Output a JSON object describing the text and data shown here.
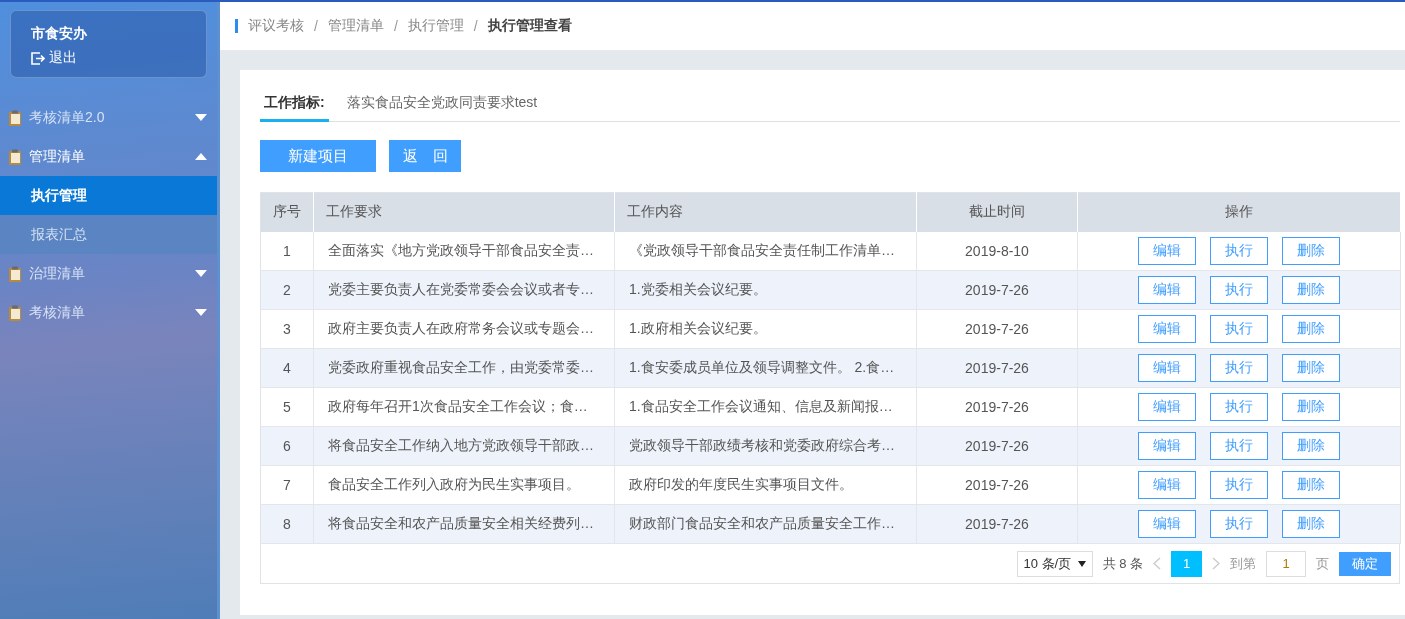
{
  "user": {
    "name": "市食安办",
    "logout": "退出"
  },
  "sidebar": {
    "items": [
      {
        "label": "考核清单2.0",
        "expanded": false
      },
      {
        "label": "管理清单",
        "expanded": true,
        "children": [
          {
            "label": "执行管理",
            "selected": true
          },
          {
            "label": "报表汇总",
            "selected": false
          }
        ]
      },
      {
        "label": "治理清单",
        "expanded": false
      },
      {
        "label": "考核清单",
        "expanded": false
      }
    ]
  },
  "breadcrumb_separator": "/",
  "breadcrumb": [
    {
      "label": "评议考核",
      "current": false
    },
    {
      "label": "管理清单",
      "current": false
    },
    {
      "label": "执行管理",
      "current": false
    },
    {
      "label": "执行管理查看",
      "current": true
    }
  ],
  "tabs": [
    {
      "label": "工作指标:",
      "selected": true
    }
  ],
  "indicator": "落实食品安全党政同责要求test",
  "buttons": [
    "新建项目",
    "返　回"
  ],
  "table": {
    "columns": [
      "序号",
      "工作要求",
      "工作内容",
      "截止时间",
      "操作"
    ],
    "rows": [
      {
        "no": "1",
        "requirement": "全面落实《地方党政领导干部食品安全责…",
        "content": "《党政领导干部食品安全责任制工作清单…",
        "deadline": "2019-8-10",
        "actions": [
          "编辑",
          "执行",
          "删除"
        ]
      },
      {
        "no": "2",
        "requirement": "党委主要负责人在党委常委会会议或者专…",
        "content": "1.党委相关会议纪要。",
        "deadline": "2019-7-26",
        "actions": [
          "编辑",
          "执行",
          "删除"
        ]
      },
      {
        "no": "3",
        "requirement": "政府主要负责人在政府常务会议或专题会…",
        "content": "1.政府相关会议纪要。",
        "deadline": "2019-7-26",
        "actions": [
          "编辑",
          "执行",
          "删除"
        ]
      },
      {
        "no": "4",
        "requirement": "党委政府重视食品安全工作，由党委常委…",
        "content": "1.食安委成员单位及领导调整文件。 2.食…",
        "deadline": "2019-7-26",
        "actions": [
          "编辑",
          "执行",
          "删除"
        ]
      },
      {
        "no": "5",
        "requirement": "政府每年召开1次食品安全工作会议；食…",
        "content": "1.食品安全工作会议通知、信息及新闻报…",
        "deadline": "2019-7-26",
        "actions": [
          "编辑",
          "执行",
          "删除"
        ]
      },
      {
        "no": "6",
        "requirement": "将食品安全工作纳入地方党政领导干部政…",
        "content": "党政领导干部政绩考核和党委政府综合考…",
        "deadline": "2019-7-26",
        "actions": [
          "编辑",
          "执行",
          "删除"
        ]
      },
      {
        "no": "7",
        "requirement": "食品安全工作列入政府为民生实事项目。",
        "content": "政府印发的年度民生实事项目文件。",
        "deadline": "2019-7-26",
        "actions": [
          "编辑",
          "执行",
          "删除"
        ]
      },
      {
        "no": "8",
        "requirement": "将食品安全和农产品质量安全相关经费列…",
        "content": "财政部门食品安全和农产品质量安全工作…",
        "deadline": "2019-7-26",
        "actions": [
          "编辑",
          "执行",
          "删除"
        ]
      }
    ]
  },
  "pagination": {
    "page_size": "10 条/页",
    "total": "共 8 条",
    "pages": [
      {
        "label": "1",
        "selected": true
      }
    ],
    "goto_label": "到第",
    "goto_value": "1",
    "page_unit": "页",
    "confirm": "确定"
  }
}
